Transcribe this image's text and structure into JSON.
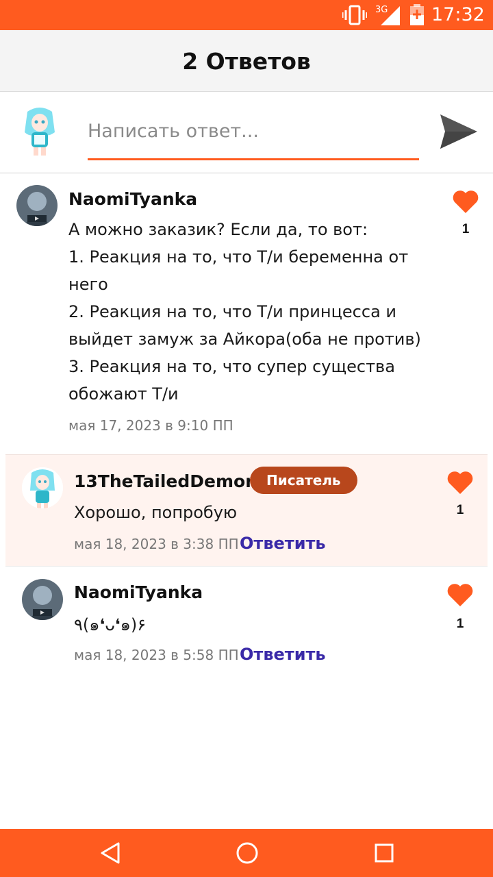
{
  "status_bar": {
    "network": "3G",
    "time": "17:32",
    "icons": [
      "vibrate-icon",
      "signal-icon",
      "battery-charging-icon"
    ]
  },
  "header": {
    "title": "2 Ответов"
  },
  "compose": {
    "placeholder": "Написать ответ...",
    "value": "",
    "send_icon": "send-icon"
  },
  "comments": [
    {
      "username": "NaomiTyanka",
      "lines": [
        "А можно заказик? Если да, то вот:",
        "1. Реакция на то, что Т/и беременна от",
        "него",
        "2. Реакция на то, что Т/и принцесса и",
        "выйдет замуж за Айкора(оба не против)",
        "3. Реакция на то, что супер существа",
        "обожают Т/и"
      ],
      "timestamp": "мая 17, 2023 в 9:10 ПП",
      "likes": "1"
    },
    {
      "username": "13TheTailedDemon",
      "badge": "Писатель",
      "text": "Хорошо, попробую",
      "timestamp": "мая 18, 2023 в 3:38 ПП",
      "reply_label": "Ответить",
      "likes": "1"
    },
    {
      "username": "NaomiTyanka",
      "text": "٩(๑❛ᴗ❛๑)۶",
      "timestamp": "мая 18, 2023 в 5:58 ПП",
      "reply_label": "Ответить",
      "likes": "1"
    }
  ],
  "colors": {
    "accent": "#ff5b1f",
    "badge": "#b8471c",
    "heart": "#ff5b1f",
    "reply_link": "#3a2aa8",
    "highlight_bg": "#fff3ef"
  },
  "navbar": {
    "icons": [
      "back-icon",
      "home-icon",
      "recents-icon"
    ]
  }
}
